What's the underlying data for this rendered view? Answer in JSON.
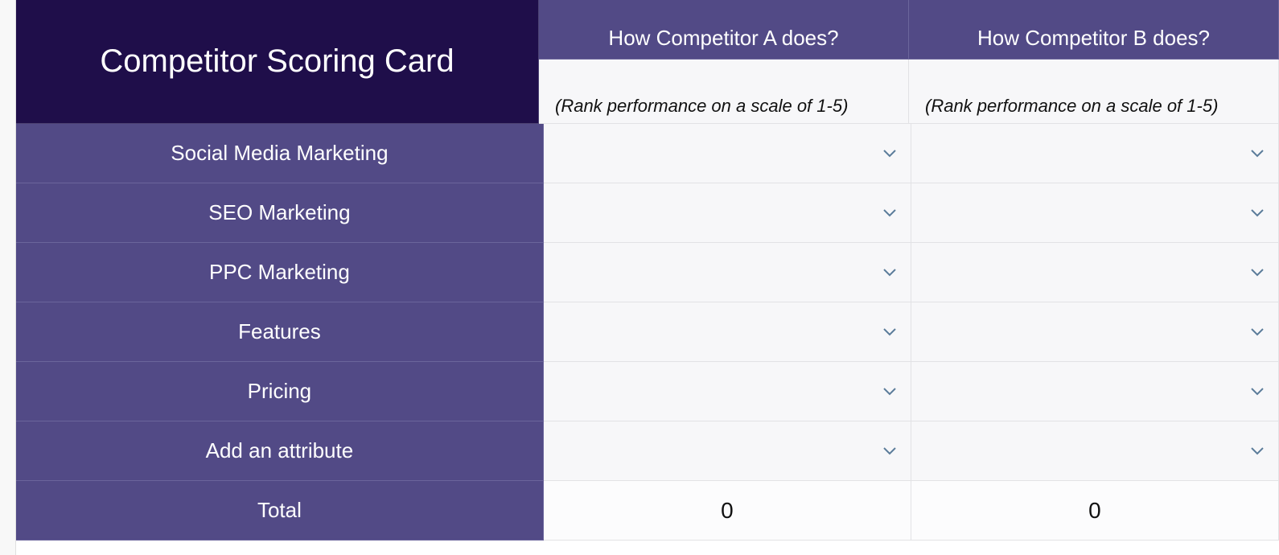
{
  "title": "Competitor Scoring Card",
  "columns": {
    "a": {
      "header": "How Competitor A does?",
      "sub": "(Rank performance on a scale of 1-5)",
      "total": "0"
    },
    "b": {
      "header": "How Competitor B does?",
      "sub": "(Rank performance on a scale of 1-5)",
      "total": "0"
    }
  },
  "attributes": [
    "Social Media Marketing",
    "SEO Marketing",
    "PPC Marketing",
    "Features",
    "Pricing",
    "Add an attribute"
  ],
  "total_label": "Total"
}
